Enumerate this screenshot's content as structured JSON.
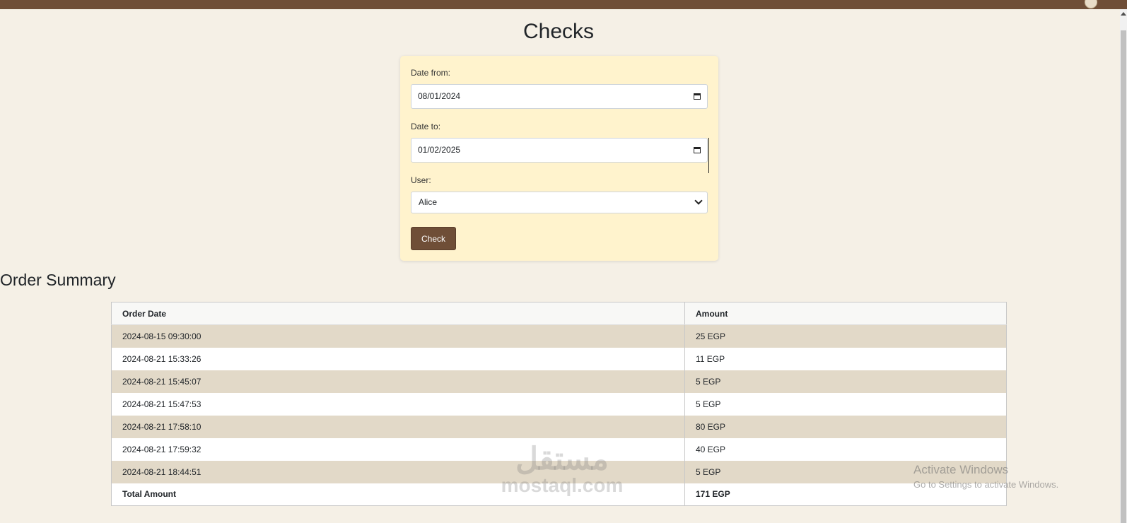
{
  "page": {
    "title": "Checks"
  },
  "form": {
    "date_from_label": "Date from:",
    "date_from_value": "08/01/2024",
    "date_to_label": "Date to:",
    "date_to_value": "01/02/2025",
    "user_label": "User:",
    "user_selected": "Alice",
    "submit_label": "Check"
  },
  "summary": {
    "title": "Order Summary",
    "columns": [
      "Order Date",
      "Amount"
    ],
    "rows": [
      [
        "2024-08-15 09:30:00",
        "25 EGP"
      ],
      [
        "2024-08-21 15:33:26",
        "11 EGP"
      ],
      [
        "2024-08-21 15:45:07",
        "5 EGP"
      ],
      [
        "2024-08-21 15:47:53",
        "5 EGP"
      ],
      [
        "2024-08-21 17:58:10",
        "80 EGP"
      ],
      [
        "2024-08-21 17:59:32",
        "40 EGP"
      ],
      [
        "2024-08-21 18:44:51",
        "5 EGP"
      ]
    ],
    "total_label": "Total Amount",
    "total_value": "171 EGP"
  },
  "watermark": {
    "arabic": "مستقل",
    "latin": "mostaql.com"
  },
  "os_notice": {
    "line1": "Activate Windows",
    "line2": "Go to Settings to activate Windows."
  },
  "colors": {
    "brand_brown": "#6f4e37",
    "page_bg": "#f5f0e6",
    "card_bg": "#fff3cd",
    "stripe": "#e2d9c8"
  }
}
